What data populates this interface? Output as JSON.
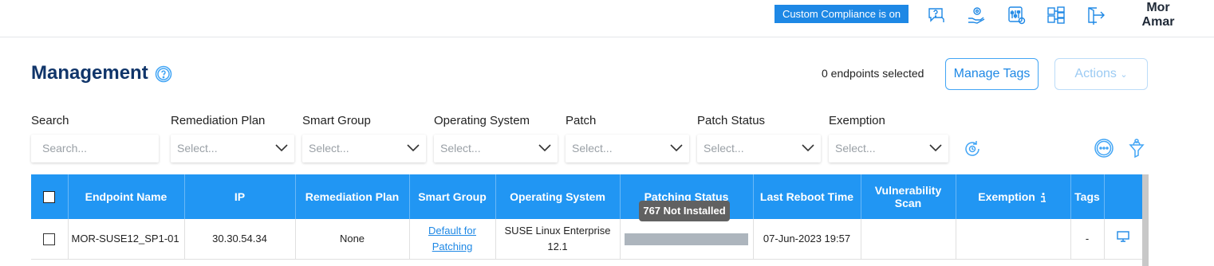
{
  "topbar": {
    "compliance_badge": "Custom Compliance is on",
    "icons": [
      "support-chat-icon",
      "settings-hand-icon",
      "sliders-icon",
      "hierarchy-icon",
      "logout-icon"
    ],
    "user_line1": "Mor",
    "user_line2": "Amar"
  },
  "page": {
    "title": "Management",
    "selected_count": "0 endpoints selected",
    "manage_tags_label": "Manage Tags",
    "actions_label": "Actions"
  },
  "filters": {
    "search": {
      "label": "Search",
      "placeholder": "Search..."
    },
    "remediation_plan": {
      "label": "Remediation Plan",
      "placeholder": "Select..."
    },
    "smart_group": {
      "label": "Smart Group",
      "placeholder": "Select..."
    },
    "operating_system": {
      "label": "Operating System",
      "placeholder": "Select..."
    },
    "patch": {
      "label": "Patch",
      "placeholder": "Select..."
    },
    "patch_status": {
      "label": "Patch Status",
      "placeholder": "Select..."
    },
    "exemption": {
      "label": "Exemption",
      "placeholder": "Select..."
    }
  },
  "table": {
    "columns": {
      "endpoint_name": "Endpoint Name",
      "ip": "IP",
      "remediation_plan": "Remediation Plan",
      "smart_group": "Smart Group",
      "operating_system": "Operating System",
      "patching_status": "Patching Status",
      "last_reboot": "Last Reboot Time",
      "vulnerability_scan": "Vulnerability Scan",
      "exemption": "Exemption",
      "tags": "Tags"
    },
    "rows": [
      {
        "endpoint_name": "MOR-SUSE12_SP1-01",
        "ip": "30.30.54.34",
        "remediation_plan": "None",
        "smart_group_line1": "Default for",
        "smart_group_line2": "Patching",
        "os_line1": "SUSE Linux Enterprise",
        "os_line2": "12.1",
        "last_reboot": "07-Jun-2023 19:57",
        "vulnerability_scan": "",
        "exemption": "",
        "tags": "-"
      }
    ],
    "tooltip": "767 Not Installed"
  },
  "colors": {
    "accent": "#2196f3",
    "title": "#10356a",
    "badge": "#1e88e5"
  }
}
